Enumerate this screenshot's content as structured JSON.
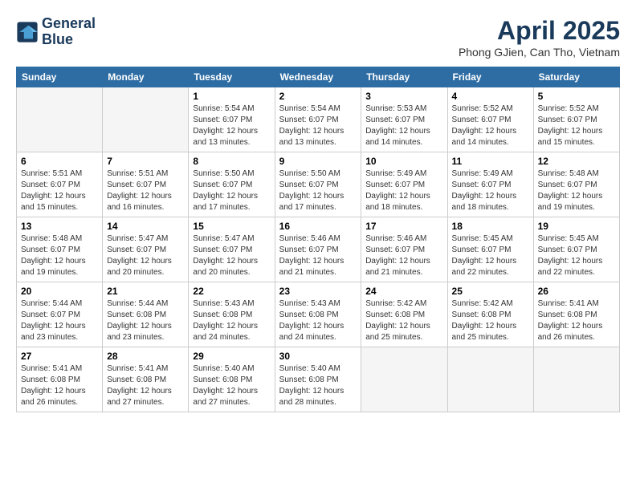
{
  "logo": {
    "line1": "General",
    "line2": "Blue"
  },
  "title": "April 2025",
  "location": "Phong GJien, Can Tho, Vietnam",
  "headers": [
    "Sunday",
    "Monday",
    "Tuesday",
    "Wednesday",
    "Thursday",
    "Friday",
    "Saturday"
  ],
  "weeks": [
    [
      {
        "day": "",
        "info": ""
      },
      {
        "day": "",
        "info": ""
      },
      {
        "day": "1",
        "info": "Sunrise: 5:54 AM\nSunset: 6:07 PM\nDaylight: 12 hours\nand 13 minutes."
      },
      {
        "day": "2",
        "info": "Sunrise: 5:54 AM\nSunset: 6:07 PM\nDaylight: 12 hours\nand 13 minutes."
      },
      {
        "day": "3",
        "info": "Sunrise: 5:53 AM\nSunset: 6:07 PM\nDaylight: 12 hours\nand 14 minutes."
      },
      {
        "day": "4",
        "info": "Sunrise: 5:52 AM\nSunset: 6:07 PM\nDaylight: 12 hours\nand 14 minutes."
      },
      {
        "day": "5",
        "info": "Sunrise: 5:52 AM\nSunset: 6:07 PM\nDaylight: 12 hours\nand 15 minutes."
      }
    ],
    [
      {
        "day": "6",
        "info": "Sunrise: 5:51 AM\nSunset: 6:07 PM\nDaylight: 12 hours\nand 15 minutes."
      },
      {
        "day": "7",
        "info": "Sunrise: 5:51 AM\nSunset: 6:07 PM\nDaylight: 12 hours\nand 16 minutes."
      },
      {
        "day": "8",
        "info": "Sunrise: 5:50 AM\nSunset: 6:07 PM\nDaylight: 12 hours\nand 17 minutes."
      },
      {
        "day": "9",
        "info": "Sunrise: 5:50 AM\nSunset: 6:07 PM\nDaylight: 12 hours\nand 17 minutes."
      },
      {
        "day": "10",
        "info": "Sunrise: 5:49 AM\nSunset: 6:07 PM\nDaylight: 12 hours\nand 18 minutes."
      },
      {
        "day": "11",
        "info": "Sunrise: 5:49 AM\nSunset: 6:07 PM\nDaylight: 12 hours\nand 18 minutes."
      },
      {
        "day": "12",
        "info": "Sunrise: 5:48 AM\nSunset: 6:07 PM\nDaylight: 12 hours\nand 19 minutes."
      }
    ],
    [
      {
        "day": "13",
        "info": "Sunrise: 5:48 AM\nSunset: 6:07 PM\nDaylight: 12 hours\nand 19 minutes."
      },
      {
        "day": "14",
        "info": "Sunrise: 5:47 AM\nSunset: 6:07 PM\nDaylight: 12 hours\nand 20 minutes."
      },
      {
        "day": "15",
        "info": "Sunrise: 5:47 AM\nSunset: 6:07 PM\nDaylight: 12 hours\nand 20 minutes."
      },
      {
        "day": "16",
        "info": "Sunrise: 5:46 AM\nSunset: 6:07 PM\nDaylight: 12 hours\nand 21 minutes."
      },
      {
        "day": "17",
        "info": "Sunrise: 5:46 AM\nSunset: 6:07 PM\nDaylight: 12 hours\nand 21 minutes."
      },
      {
        "day": "18",
        "info": "Sunrise: 5:45 AM\nSunset: 6:07 PM\nDaylight: 12 hours\nand 22 minutes."
      },
      {
        "day": "19",
        "info": "Sunrise: 5:45 AM\nSunset: 6:07 PM\nDaylight: 12 hours\nand 22 minutes."
      }
    ],
    [
      {
        "day": "20",
        "info": "Sunrise: 5:44 AM\nSunset: 6:07 PM\nDaylight: 12 hours\nand 23 minutes."
      },
      {
        "day": "21",
        "info": "Sunrise: 5:44 AM\nSunset: 6:08 PM\nDaylight: 12 hours\nand 23 minutes."
      },
      {
        "day": "22",
        "info": "Sunrise: 5:43 AM\nSunset: 6:08 PM\nDaylight: 12 hours\nand 24 minutes."
      },
      {
        "day": "23",
        "info": "Sunrise: 5:43 AM\nSunset: 6:08 PM\nDaylight: 12 hours\nand 24 minutes."
      },
      {
        "day": "24",
        "info": "Sunrise: 5:42 AM\nSunset: 6:08 PM\nDaylight: 12 hours\nand 25 minutes."
      },
      {
        "day": "25",
        "info": "Sunrise: 5:42 AM\nSunset: 6:08 PM\nDaylight: 12 hours\nand 25 minutes."
      },
      {
        "day": "26",
        "info": "Sunrise: 5:41 AM\nSunset: 6:08 PM\nDaylight: 12 hours\nand 26 minutes."
      }
    ],
    [
      {
        "day": "27",
        "info": "Sunrise: 5:41 AM\nSunset: 6:08 PM\nDaylight: 12 hours\nand 26 minutes."
      },
      {
        "day": "28",
        "info": "Sunrise: 5:41 AM\nSunset: 6:08 PM\nDaylight: 12 hours\nand 27 minutes."
      },
      {
        "day": "29",
        "info": "Sunrise: 5:40 AM\nSunset: 6:08 PM\nDaylight: 12 hours\nand 27 minutes."
      },
      {
        "day": "30",
        "info": "Sunrise: 5:40 AM\nSunset: 6:08 PM\nDaylight: 12 hours\nand 28 minutes."
      },
      {
        "day": "",
        "info": ""
      },
      {
        "day": "",
        "info": ""
      },
      {
        "day": "",
        "info": ""
      }
    ]
  ]
}
